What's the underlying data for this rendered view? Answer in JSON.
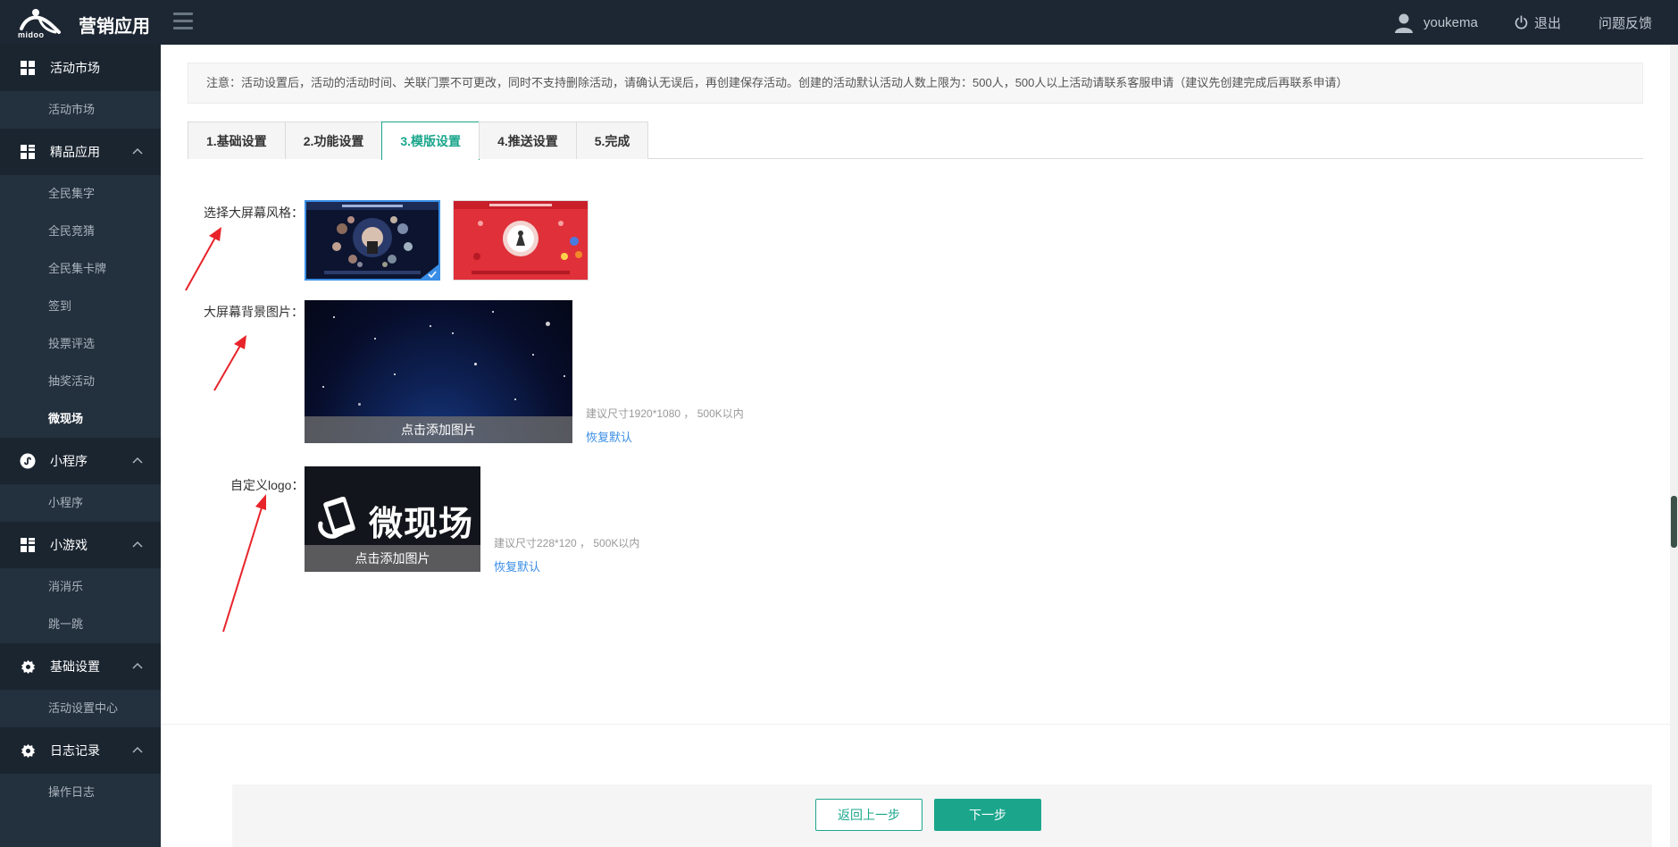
{
  "topbar": {
    "brand_small": "midoo",
    "app_title": "营销应用",
    "username": "youkema",
    "logout_label": "退出",
    "feedback_label": "问题反馈"
  },
  "sidebar": {
    "groups": [
      {
        "label": "活动市场",
        "icon": "grid-apps-icon",
        "items": [
          "活动市场"
        ]
      },
      {
        "label": "精品应用",
        "icon": "grid-apps-icon",
        "items": [
          "全民集字",
          "全民竞猜",
          "全民集卡牌",
          "签到",
          "投票评选",
          "抽奖活动",
          "微现场"
        ]
      },
      {
        "label": "小程序",
        "icon": "miniprogram-icon",
        "items": [
          "小程序"
        ]
      },
      {
        "label": "小游戏",
        "icon": "grid-apps-icon",
        "items": [
          "消消乐",
          "跳一跳"
        ]
      },
      {
        "label": "基础设置",
        "icon": "gear-icon",
        "items": [
          "活动设置中心"
        ]
      },
      {
        "label": "日志记录",
        "icon": "gear-icon",
        "items": [
          "操作日志"
        ]
      }
    ],
    "active_item": "微现场"
  },
  "main": {
    "notice": "注意：活动设置后，活动的活动时间、关联门票不可更改，同时不支持删除活动，请确认无误后，再创建保存活动。创建的活动默认活动人数上限为：500人，500人以上活动请联系客服申请（建议先创建完成后再联系申请）",
    "tabs": [
      "1.基础设置",
      "2.功能设置",
      "3.模版设置",
      "4.推送设置",
      "5.完成"
    ],
    "active_tab": "3.模版设置",
    "style_label": "选择大屏幕风格：",
    "bg_label": "大屏幕背景图片：",
    "bg_upload_label": "点击添加图片",
    "bg_hint": "建议尺寸1920*1080 ， 500K以内",
    "bg_restore": "恢复默认",
    "logo_label": "自定义logo：",
    "logo_text": "微现场",
    "logo_upload_label": "点击添加图片",
    "logo_hint": "建议尺寸228*120 ， 500K以内",
    "logo_restore": "恢复默认"
  },
  "footer": {
    "prev_label": "返回上一步",
    "next_label": "下一步"
  },
  "colors": {
    "accent": "#1ba68c",
    "link": "#3a8ee6",
    "topbar": "#1d2733",
    "sidebar": "#23303d",
    "annotation_arrow": "#e8242a"
  }
}
